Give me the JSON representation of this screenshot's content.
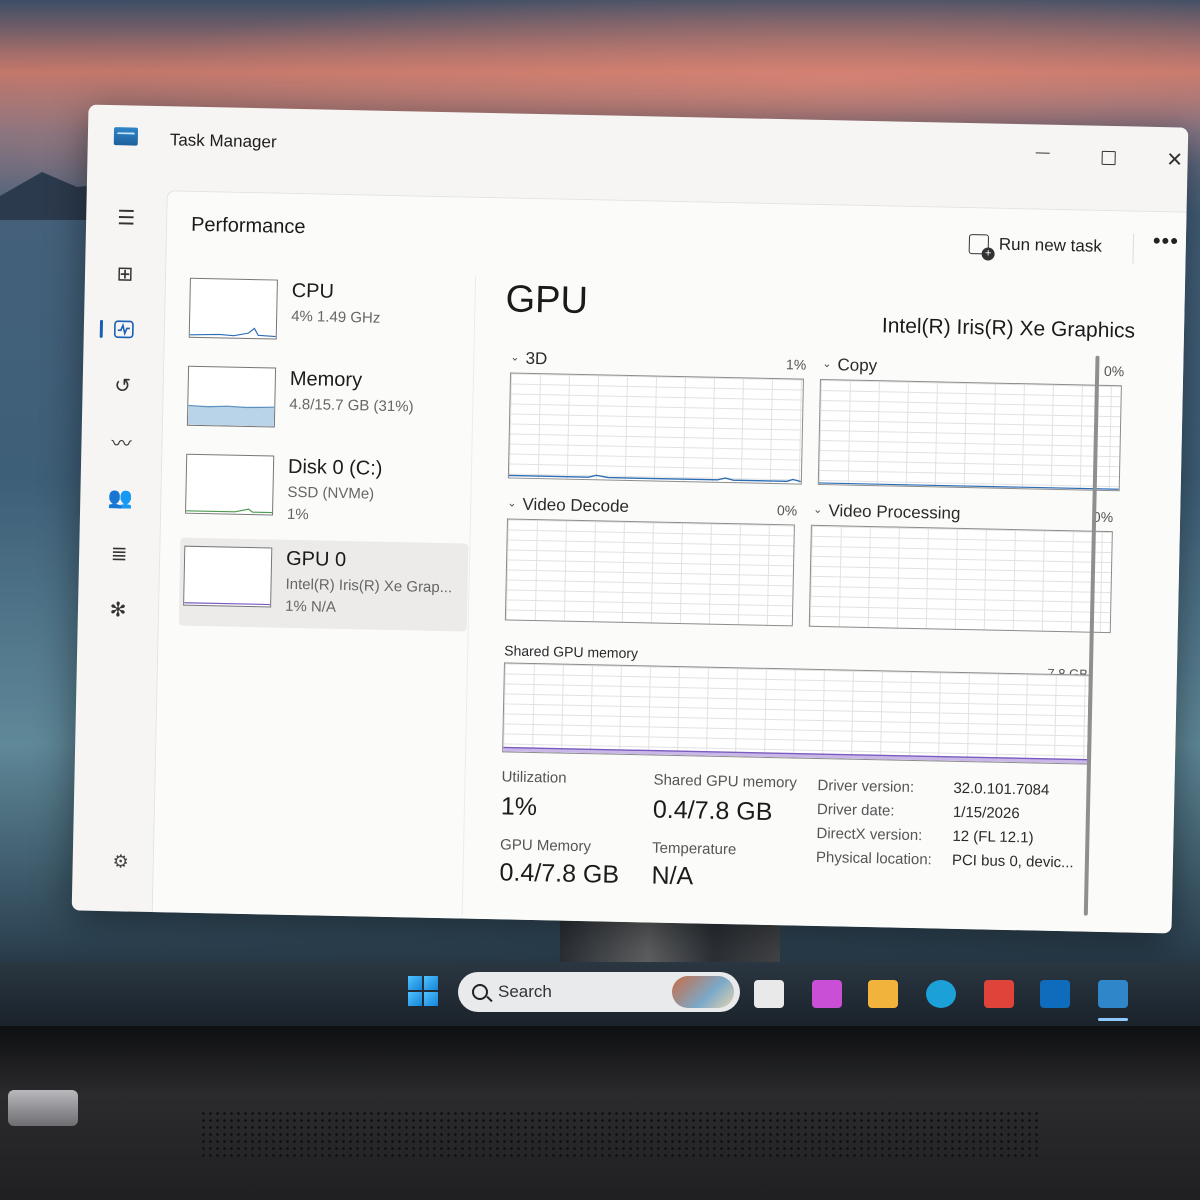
{
  "window": {
    "title": "Task Manager"
  },
  "header": {
    "page_title": "Performance",
    "run_new_task": "Run new task",
    "more_glyph": "•••"
  },
  "nav": {
    "icons": [
      "hamburger-icon",
      "processes-icon",
      "performance-icon",
      "app-history-icon",
      "startup-apps-icon",
      "users-icon",
      "details-icon",
      "services-icon",
      "settings-icon"
    ],
    "active": "performance-icon"
  },
  "devices": [
    {
      "name": "CPU",
      "line1": "4%  1.49 GHz",
      "line2": ""
    },
    {
      "name": "Memory",
      "line1": "4.8/15.7 GB (31%)",
      "line2": ""
    },
    {
      "name": "Disk 0 (C:)",
      "line1": "SSD (NVMe)",
      "line2": "1%"
    },
    {
      "name": "GPU 0",
      "line1": "Intel(R) Iris(R) Xe Grap...",
      "line2": "1%  N/A"
    }
  ],
  "gpu": {
    "title": "GPU",
    "model": "Intel(R) Iris(R) Xe Graphics",
    "engines": [
      {
        "label": "3D",
        "percent": "1%",
        "value": 1
      },
      {
        "label": "Copy",
        "percent": "0%",
        "value": 0
      },
      {
        "label": "Video Decode",
        "percent": "0%",
        "value": 0
      },
      {
        "label": "Video Processing",
        "percent": "0%",
        "value": 0
      }
    ],
    "shared_memory_graph": {
      "label": "Shared GPU memory",
      "max": "7.8 GB"
    },
    "stats": {
      "utilization_label": "Utilization",
      "utilization_value": "1%",
      "shared_label": "Shared GPU memory",
      "shared_value": "0.4/7.8 GB",
      "gpu_memory_label": "GPU Memory",
      "gpu_memory_value": "0.4/7.8 GB",
      "temperature_label": "Temperature",
      "temperature_value": "N/A"
    },
    "info": [
      {
        "key": "Driver version:",
        "value": "32.0.101.7084"
      },
      {
        "key": "Driver date:",
        "value": "1/15/2026"
      },
      {
        "key": "DirectX version:",
        "value": "12 (FL 12.1)"
      },
      {
        "key": "Physical location:",
        "value": "PCI bus 0, devic..."
      }
    ]
  },
  "taskbar": {
    "search_label": "Search",
    "colors": {
      "accent": "#1683d8",
      "copilot": "#c94fd6",
      "explorer": "#f2b33d",
      "edge": "#1ba1d8",
      "store": "#e0433a",
      "outlook": "#0f6cbd",
      "taskmgr": "#2f86c8"
    }
  }
}
